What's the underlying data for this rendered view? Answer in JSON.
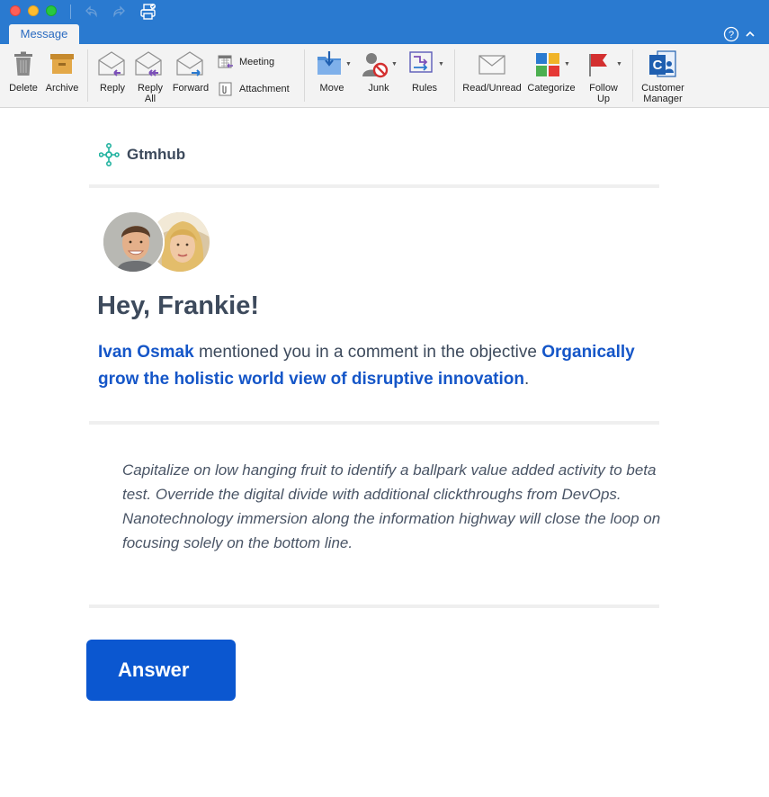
{
  "window": {
    "tabs": [
      {
        "label": "Message",
        "active": true
      }
    ],
    "accent_color": "#2a7ad0"
  },
  "ribbon": {
    "groups": [
      {
        "buttons": [
          {
            "label": "Delete",
            "icon": "trash-icon"
          },
          {
            "label": "Archive",
            "icon": "archive-box-icon"
          }
        ]
      },
      {
        "buttons": [
          {
            "label": "Reply",
            "icon": "reply-envelope-icon"
          },
          {
            "label": "Reply\nAll",
            "icon": "reply-all-envelope-icon"
          },
          {
            "label": "Forward",
            "icon": "forward-envelope-icon"
          },
          {
            "label": "Meeting",
            "icon": "meeting-calendar-icon"
          },
          {
            "label": "Attachment",
            "icon": "attachment-icon"
          }
        ]
      },
      {
        "buttons": [
          {
            "label": "Move",
            "icon": "move-folder-icon"
          },
          {
            "label": "Junk",
            "icon": "junk-person-icon"
          },
          {
            "label": "Rules",
            "icon": "rules-icon"
          }
        ]
      },
      {
        "buttons": [
          {
            "label": "Read/Unread",
            "icon": "envelope-icon"
          },
          {
            "label": "Categorize",
            "icon": "category-squares-icon"
          },
          {
            "label": "Follow\nUp",
            "icon": "red-flag-icon"
          }
        ]
      },
      {
        "buttons": [
          {
            "label": "Customer\nManager",
            "icon": "customer-manager-icon"
          }
        ]
      }
    ]
  },
  "email": {
    "brand": "Gtmhub",
    "greeting": "Hey, Frankie!",
    "mention": {
      "author": "Ivan Osmak",
      "text": " mentioned you in a comment in the objective ",
      "objective": "Organically grow the holistic world view of disruptive innovation",
      "end": "."
    },
    "comment": "Capitalize on low hanging fruit to identify a ballpark value added activity to beta test. Override the digital divide with additional clickthroughs from DevOps. Nanotechnology immersion along the information highway will close the loop on focusing solely on the bottom line.",
    "button_label": "Answer",
    "link_color": "#1556c8",
    "button_color": "#0b57d0"
  }
}
